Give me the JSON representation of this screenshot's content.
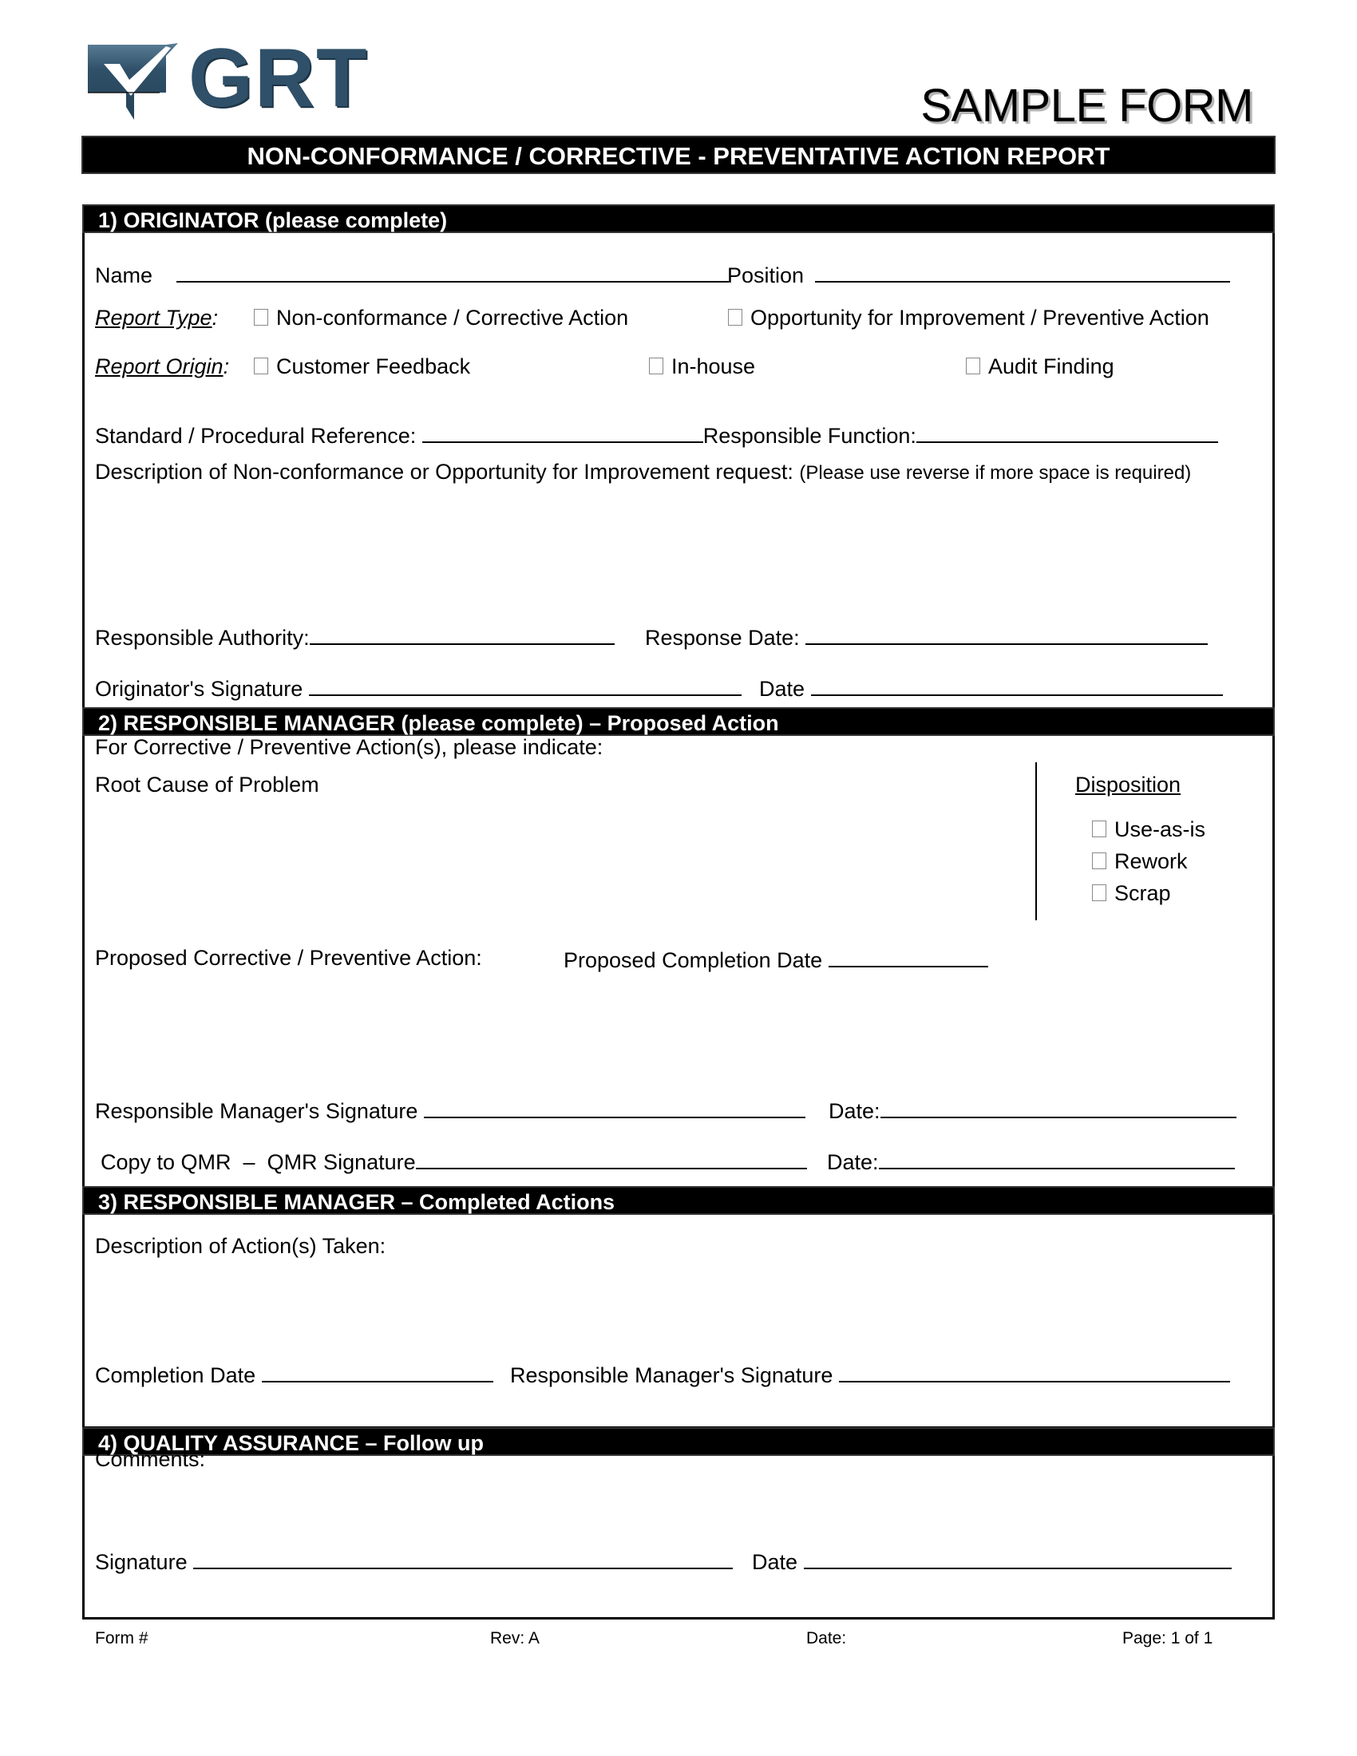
{
  "header": {
    "logo_text": "GRT",
    "logo_icon": "checkbox-check-icon",
    "logo_color": "#2f5068",
    "sample_label": "SAMPLE FORM",
    "title": "NON-CONFORMANCE / CORRECTIVE - PREVENTATIVE ACTION REPORT"
  },
  "section1": {
    "heading": "1) ORIGINATOR (please complete)",
    "name_label": "Name",
    "position_label": "Position",
    "report_type_label": "Report Type",
    "report_type_options": [
      {
        "label": "Non-conformance / Corrective Action",
        "checked": false
      },
      {
        "label": "Opportunity for Improvement / Preventive Action",
        "checked": false
      }
    ],
    "report_origin_label": "Report Origin",
    "report_origin_options": [
      {
        "label": "Customer Feedback",
        "checked": false
      },
      {
        "label": "In-house",
        "checked": false
      },
      {
        "label": "Audit Finding",
        "checked": false
      }
    ],
    "standard_ref_label": "Standard / Procedural Reference:",
    "responsible_function_label": "Responsible Function:",
    "description_label": "Description of Non-conformance or Opportunity for Improvement request:",
    "description_note": "(Please use reverse if more space is required)",
    "responsible_authority_label": "Responsible Authority:",
    "response_date_label": "Response Date:",
    "originator_signature_label": "Originator's Signature",
    "date_label": "Date"
  },
  "section2": {
    "heading": "2) RESPONSIBLE MANAGER (please complete) – Proposed Action",
    "intro": "For Corrective / Preventive Action(s), please indicate:",
    "root_cause_label": "Root Cause of Problem",
    "disposition_label": "Disposition",
    "disposition_options": [
      {
        "label": "Use-as-is",
        "checked": false
      },
      {
        "label": "Rework",
        "checked": false
      },
      {
        "label": "Scrap",
        "checked": false
      }
    ],
    "proposed_action_label": "Proposed Corrective / Preventive Action:",
    "proposed_completion_label": "Proposed Completion Date",
    "manager_signature_label": "Responsible Manager's Signature",
    "date_label": "Date:",
    "qmr_label": "Copy to QMR  –  QMR Signature",
    "qmr_date_label": "Date:"
  },
  "section3": {
    "heading": "3) RESPONSIBLE MANAGER – Completed Actions",
    "actions_label": "Description of Action(s) Taken:",
    "completion_date_label": "Completion Date",
    "manager_signature_label": "Responsible Manager's Signature"
  },
  "section4": {
    "heading": "4) QUALITY ASSURANCE – Follow up",
    "comments_label": "Comments:",
    "signature_label": "Signature",
    "date_label": "Date"
  },
  "footer": {
    "form_no": "Form #",
    "rev": "Rev: A",
    "date": "Date:",
    "page": "Page: 1 of 1"
  }
}
